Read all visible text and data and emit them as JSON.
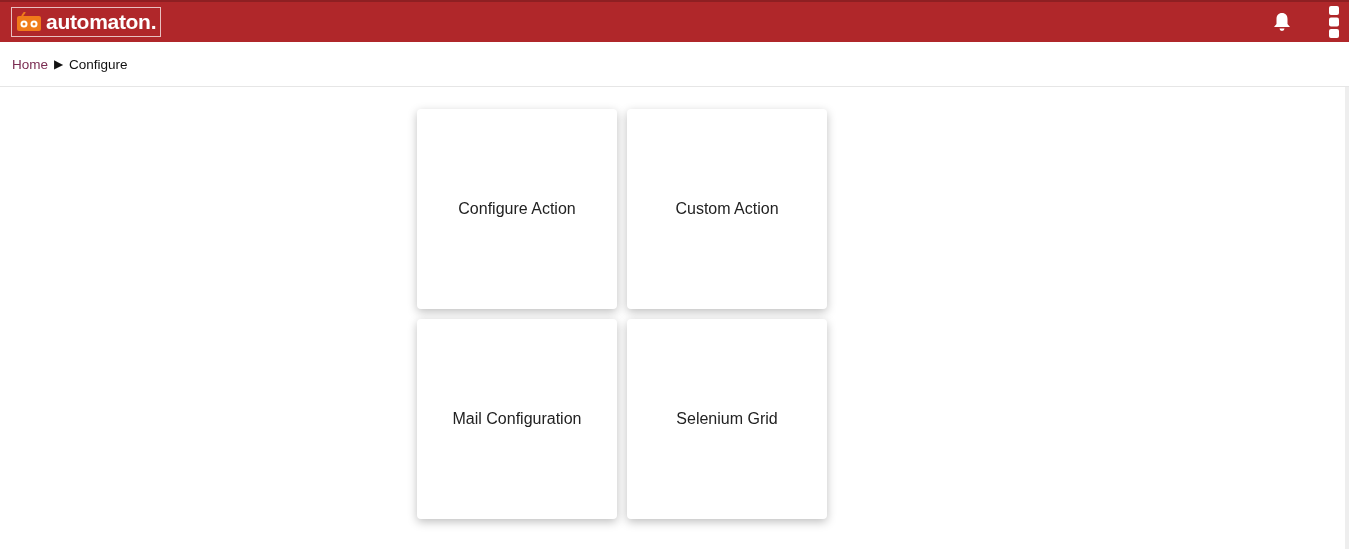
{
  "header": {
    "logo_text": "automaton."
  },
  "breadcrumb": {
    "items": [
      "Home",
      "Configure"
    ],
    "separator": "▶"
  },
  "cards": [
    {
      "label": "Configure Action"
    },
    {
      "label": "Custom Action"
    },
    {
      "label": "Mail Configuration"
    },
    {
      "label": "Selenium Grid"
    }
  ]
}
